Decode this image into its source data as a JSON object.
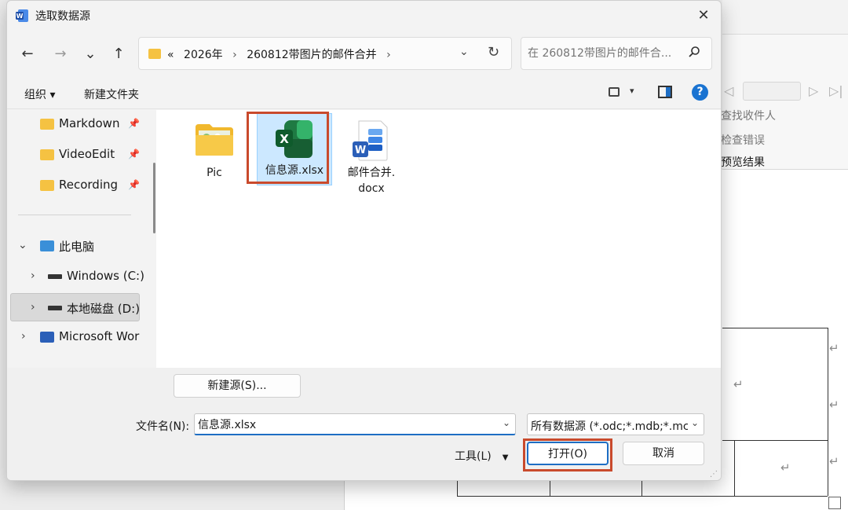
{
  "dialog": {
    "title": "选取数据源",
    "close_icon": "✕",
    "nav": {
      "back": "←",
      "forward": "→",
      "recent": "⌄",
      "up": "↑"
    },
    "address": {
      "overflow": "«",
      "crumbs": [
        "2026年",
        "260812带图片的邮件合并"
      ],
      "sep": "›",
      "dropdown": "⌄",
      "refresh": "↻"
    },
    "search": {
      "placeholder": "在 260812带图片的邮件合..."
    },
    "toolbar": {
      "organize": "组织 ▾",
      "new_folder": "新建文件夹",
      "help": "?",
      "view_dd": "▾"
    },
    "sidebar": {
      "items": [
        {
          "label": "Markdown",
          "pin": "📌"
        },
        {
          "label": "VideoEdit",
          "pin": "📌"
        },
        {
          "label": "Recording",
          "pin": "📌"
        },
        {
          "label": "此电脑",
          "chev": "⌄"
        },
        {
          "label": "Windows (C:)",
          "chev": "›"
        },
        {
          "label": "本地磁盘 (D:)",
          "chev": "›"
        },
        {
          "label": "Microsoft Wor",
          "chev": "›"
        }
      ]
    },
    "files": [
      {
        "name_line1": "Pic",
        "name_line2": ""
      },
      {
        "name_line1": "信息源.xlsx",
        "name_line2": ""
      },
      {
        "name_line1": "邮件合并.",
        "name_line2": "docx"
      }
    ],
    "footer": {
      "new_source": "新建源(S)...",
      "filename_label": "文件名(N):",
      "filename_value": "信息源.xlsx",
      "filename_dd": "⌄",
      "filetype": "所有数据源 (*.odc;*.mdb;*.mc",
      "filetype_dd": "⌄",
      "tools": "工具(L)",
      "tools_arrow": "▼",
      "open": "打开(O)",
      "cancel": "取消"
    },
    "icons": {
      "excel_letter": "X",
      "word_letter": "W"
    }
  },
  "background": {
    "ribbon_items": [
      "查找收件人",
      "检查错误",
      "预览结果"
    ],
    "nav": {
      "first": "◁",
      "next": "▷",
      "last": "▷|"
    },
    "return_mark": "↵"
  },
  "colors": {
    "accent": "#1e6ec4",
    "highlight_box": "#c94a2c",
    "excel_green": "#1f7a43",
    "word_blue": "#2b5fb8"
  }
}
